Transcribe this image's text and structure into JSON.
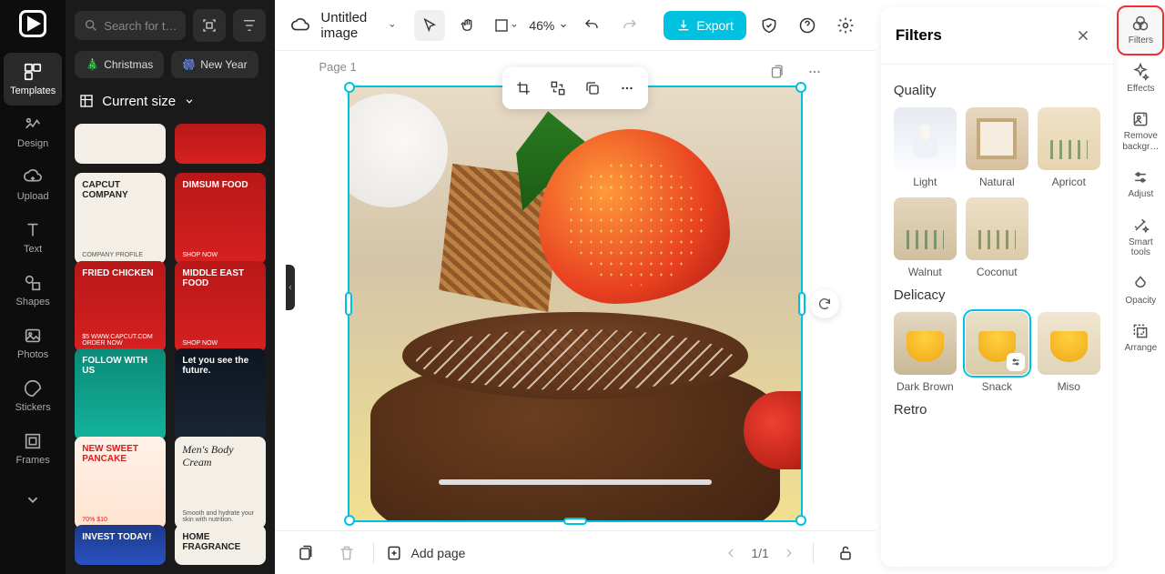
{
  "nav": {
    "items": [
      {
        "label": "Templates",
        "icon": "templates"
      },
      {
        "label": "Design",
        "icon": "design"
      },
      {
        "label": "Upload",
        "icon": "upload"
      },
      {
        "label": "Text",
        "icon": "text"
      },
      {
        "label": "Shapes",
        "icon": "shapes"
      },
      {
        "label": "Photos",
        "icon": "photos"
      },
      {
        "label": "Stickers",
        "icon": "stickers"
      },
      {
        "label": "Frames",
        "icon": "frames"
      }
    ]
  },
  "sidebar": {
    "search_placeholder": "Search for t…",
    "tags": [
      "Christmas",
      "New Year"
    ],
    "size_label": "Current size",
    "templates": [
      {
        "title": "CAPCUT COMPANY",
        "sub": "COMPANY PROFILE",
        "style": "tmpl-white"
      },
      {
        "title": "DIMSUM FOOD",
        "sub": "SHOP NOW",
        "style": "tmpl-red"
      },
      {
        "title": "FRIED CHICKEN",
        "sub": "$5  WWW.CAPCUT.COM  ORDER NOW",
        "style": "tmpl-red"
      },
      {
        "title": "MIDDLE EAST FOOD",
        "sub": "SHOP NOW",
        "style": "tmpl-red"
      },
      {
        "title": "FOLLOW WITH US",
        "sub": "",
        "style": "tmpl-teal"
      },
      {
        "title": "Let you see the future.",
        "sub": "",
        "style": "tmpl-dark"
      },
      {
        "title": "NEW SWEET PANCAKE",
        "sub": "70% $10",
        "style": "tmpl-pink"
      },
      {
        "title": "Men's Body Cream",
        "sub": "Smooth and hydrate your skin with nutrition.",
        "style": "tmpl-white"
      },
      {
        "title": "INVEST TODAY!",
        "sub": "",
        "style": "tmpl-navy"
      },
      {
        "title": "HOME FRAGRANCE",
        "sub": "",
        "style": "tmpl-white"
      }
    ]
  },
  "topbar": {
    "title": "Untitled image",
    "zoom": "46%",
    "export": "Export"
  },
  "canvas": {
    "page_label": "Page 1"
  },
  "bottombar": {
    "add_page": "Add page",
    "page_indicator": "1/1"
  },
  "filters_panel": {
    "title": "Filters",
    "groups": [
      {
        "name": "Quality",
        "items": [
          {
            "label": "Light",
            "style": "q-light"
          },
          {
            "label": "Natural",
            "style": "q-natural"
          },
          {
            "label": "Apricot",
            "style": "q-apricot"
          },
          {
            "label": "Walnut",
            "style": "q-walnut"
          },
          {
            "label": "Coconut",
            "style": "q-coconut"
          }
        ]
      },
      {
        "name": "Delicacy",
        "items": [
          {
            "label": "Dark Brown",
            "style": "d-dark"
          },
          {
            "label": "Snack",
            "style": "d-snack",
            "selected": true
          },
          {
            "label": "Miso",
            "style": "d-miso"
          }
        ]
      },
      {
        "name": "Retro",
        "items": []
      }
    ]
  },
  "right_rail": {
    "items": [
      {
        "label": "Filters",
        "icon": "filters",
        "highlighted": true
      },
      {
        "label": "Effects",
        "icon": "effects"
      },
      {
        "label": "Remove backgr…",
        "icon": "removebg"
      },
      {
        "label": "Adjust",
        "icon": "adjust"
      },
      {
        "label": "Smart tools",
        "icon": "smart"
      },
      {
        "label": "Opacity",
        "icon": "opacity"
      },
      {
        "label": "Arrange",
        "icon": "arrange"
      }
    ]
  }
}
